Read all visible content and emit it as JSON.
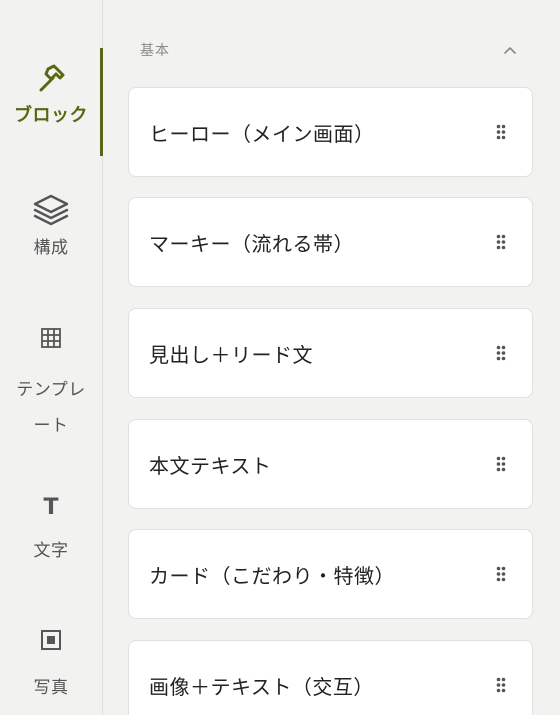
{
  "rail": {
    "items": [
      {
        "key": "block",
        "label": "ブロック",
        "icon": "hammer-icon",
        "active": true
      },
      {
        "key": "structure",
        "label": "構成",
        "icon": "layers-icon",
        "active": false
      },
      {
        "key": "template",
        "label": "テンプレート",
        "icon": "grid-icon",
        "active": false
      },
      {
        "key": "text",
        "label": "文字",
        "icon": "text-t-icon",
        "glyph": "T",
        "active": false
      },
      {
        "key": "photo",
        "label": "写真",
        "icon": "image-square-icon",
        "active": false
      }
    ],
    "accent": "#5a6614"
  },
  "section": {
    "title": "基本",
    "collapse_icon": "chevron-up-icon"
  },
  "blocks": [
    {
      "label": "ヒーロー（メイン画面）"
    },
    {
      "label": "マーキー（流れる帯）"
    },
    {
      "label": "見出し＋リード文"
    },
    {
      "label": "本文テキスト"
    },
    {
      "label": "カード（こだわり・特徴）"
    },
    {
      "label": "画像＋テキスト（交互）"
    }
  ]
}
